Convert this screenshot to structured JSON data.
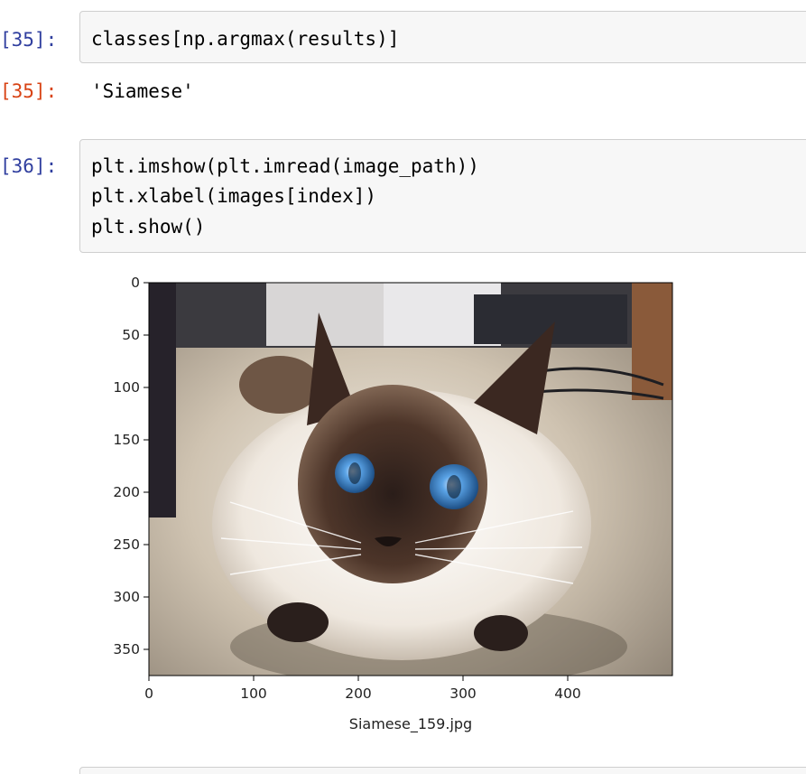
{
  "cells": {
    "c35": {
      "in_prompt": "[35]:",
      "code_lines": [
        "classes[np.argmax(results)]"
      ],
      "out_prompt": "[35]:",
      "output": "'Siamese'"
    },
    "c36": {
      "in_prompt": "[36]:",
      "code_lines": [
        "plt.imshow(plt.imread(image_path))",
        "plt.xlabel(images[index])",
        "plt.show()"
      ]
    }
  },
  "figure": {
    "image_subject": "siamese-cat-photo",
    "xlabel": "Siamese_159.jpg",
    "x_ticks": [
      0,
      100,
      200,
      300,
      400
    ],
    "y_ticks": [
      0,
      50,
      100,
      150,
      200,
      250,
      300,
      350
    ],
    "x_range": [
      0,
      500
    ],
    "y_range": [
      0,
      375
    ]
  },
  "colors": {
    "in_prompt": "#303F9F",
    "out_prompt": "#D84315",
    "input_bg": "#f7f7f7",
    "input_border": "#cfcfcf"
  }
}
